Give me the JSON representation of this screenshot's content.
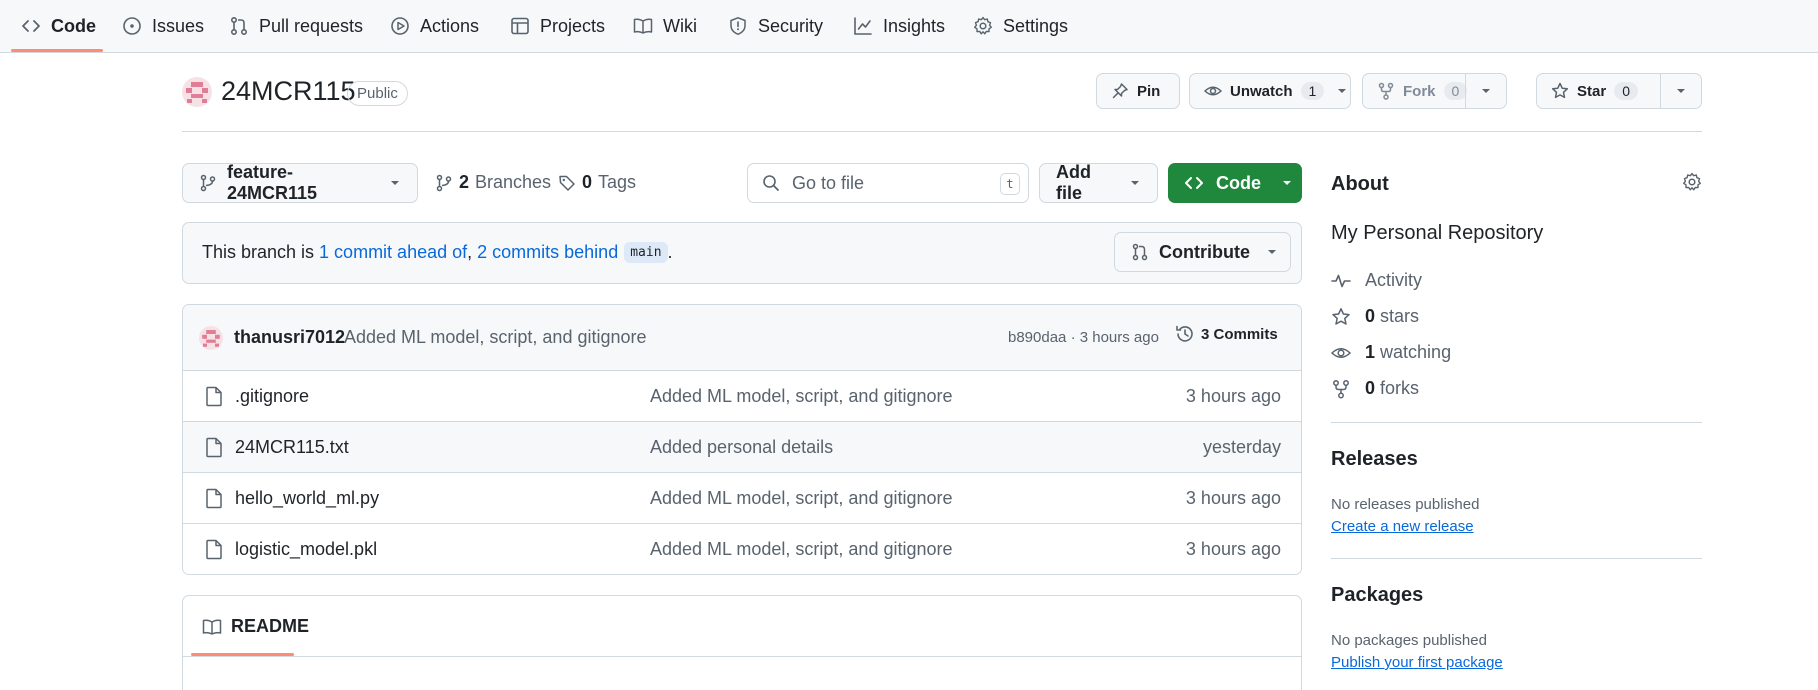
{
  "nav": {
    "tabs": [
      {
        "label": "Code",
        "icon": "code-icon",
        "selected": true
      },
      {
        "label": "Issues",
        "icon": "issue-icon"
      },
      {
        "label": "Pull requests",
        "icon": "pull-request-icon"
      },
      {
        "label": "Actions",
        "icon": "play-icon"
      },
      {
        "label": "Projects",
        "icon": "table-icon"
      },
      {
        "label": "Wiki",
        "icon": "book-icon"
      },
      {
        "label": "Security",
        "icon": "shield-icon"
      },
      {
        "label": "Insights",
        "icon": "graph-icon"
      },
      {
        "label": "Settings",
        "icon": "gear-icon"
      }
    ]
  },
  "repo": {
    "name": "24MCR115",
    "visibility": "Public",
    "pin_label": "Pin",
    "unwatch_label": "Unwatch",
    "watch_count": "1",
    "fork_label": "Fork",
    "fork_count": "0",
    "star_label": "Star",
    "star_count": "0"
  },
  "branchbar": {
    "branch": "feature-24MCR115",
    "branches_count": "2",
    "branches_label": "Branches",
    "tags_count": "0",
    "tags_label": "Tags",
    "search_placeholder": "Go to file",
    "search_shortcut": "t",
    "add_file_label": "Add file",
    "code_label": "Code"
  },
  "status": {
    "prefix": "This branch is ",
    "ahead": "1 commit ahead of",
    "separator": ", ",
    "behind": "2 commits behind",
    "base_branch": "main",
    "suffix": ".",
    "contribute_label": "Contribute"
  },
  "latest_commit": {
    "author": "thanusri7012",
    "message": "Added ML model, script, and gitignore",
    "hash_time": "b890daa · 3 hours ago",
    "commits_label": "3 Commits"
  },
  "files": [
    {
      "name": ".gitignore",
      "message": "Added ML model, script, and gitignore",
      "time": "3 hours ago"
    },
    {
      "name": "24MCR115.txt",
      "message": "Added personal details",
      "time": "yesterday"
    },
    {
      "name": "hello_world_ml.py",
      "message": "Added ML model, script, and gitignore",
      "time": "3 hours ago"
    },
    {
      "name": "logistic_model.pkl",
      "message": "Added ML model, script, and gitignore",
      "time": "3 hours ago"
    }
  ],
  "readme": {
    "label": "README"
  },
  "about": {
    "heading": "About",
    "description": "My Personal Repository",
    "activity_label": "Activity",
    "stars_count": "0",
    "stars_label": "stars",
    "watching_count": "1",
    "watching_label": "watching",
    "forks_count": "0",
    "forks_label": "forks"
  },
  "releases": {
    "heading": "Releases",
    "empty_text": "No releases published",
    "link": "Create a new release"
  },
  "packages": {
    "heading": "Packages",
    "empty_text": "No packages published",
    "link": "Publish your first package"
  },
  "colors": {
    "accent_underline": "#fd8c73",
    "link": "#0969da",
    "code_button": "#1f883d",
    "border": "#d1d9e0",
    "muted_text": "#59636e"
  }
}
